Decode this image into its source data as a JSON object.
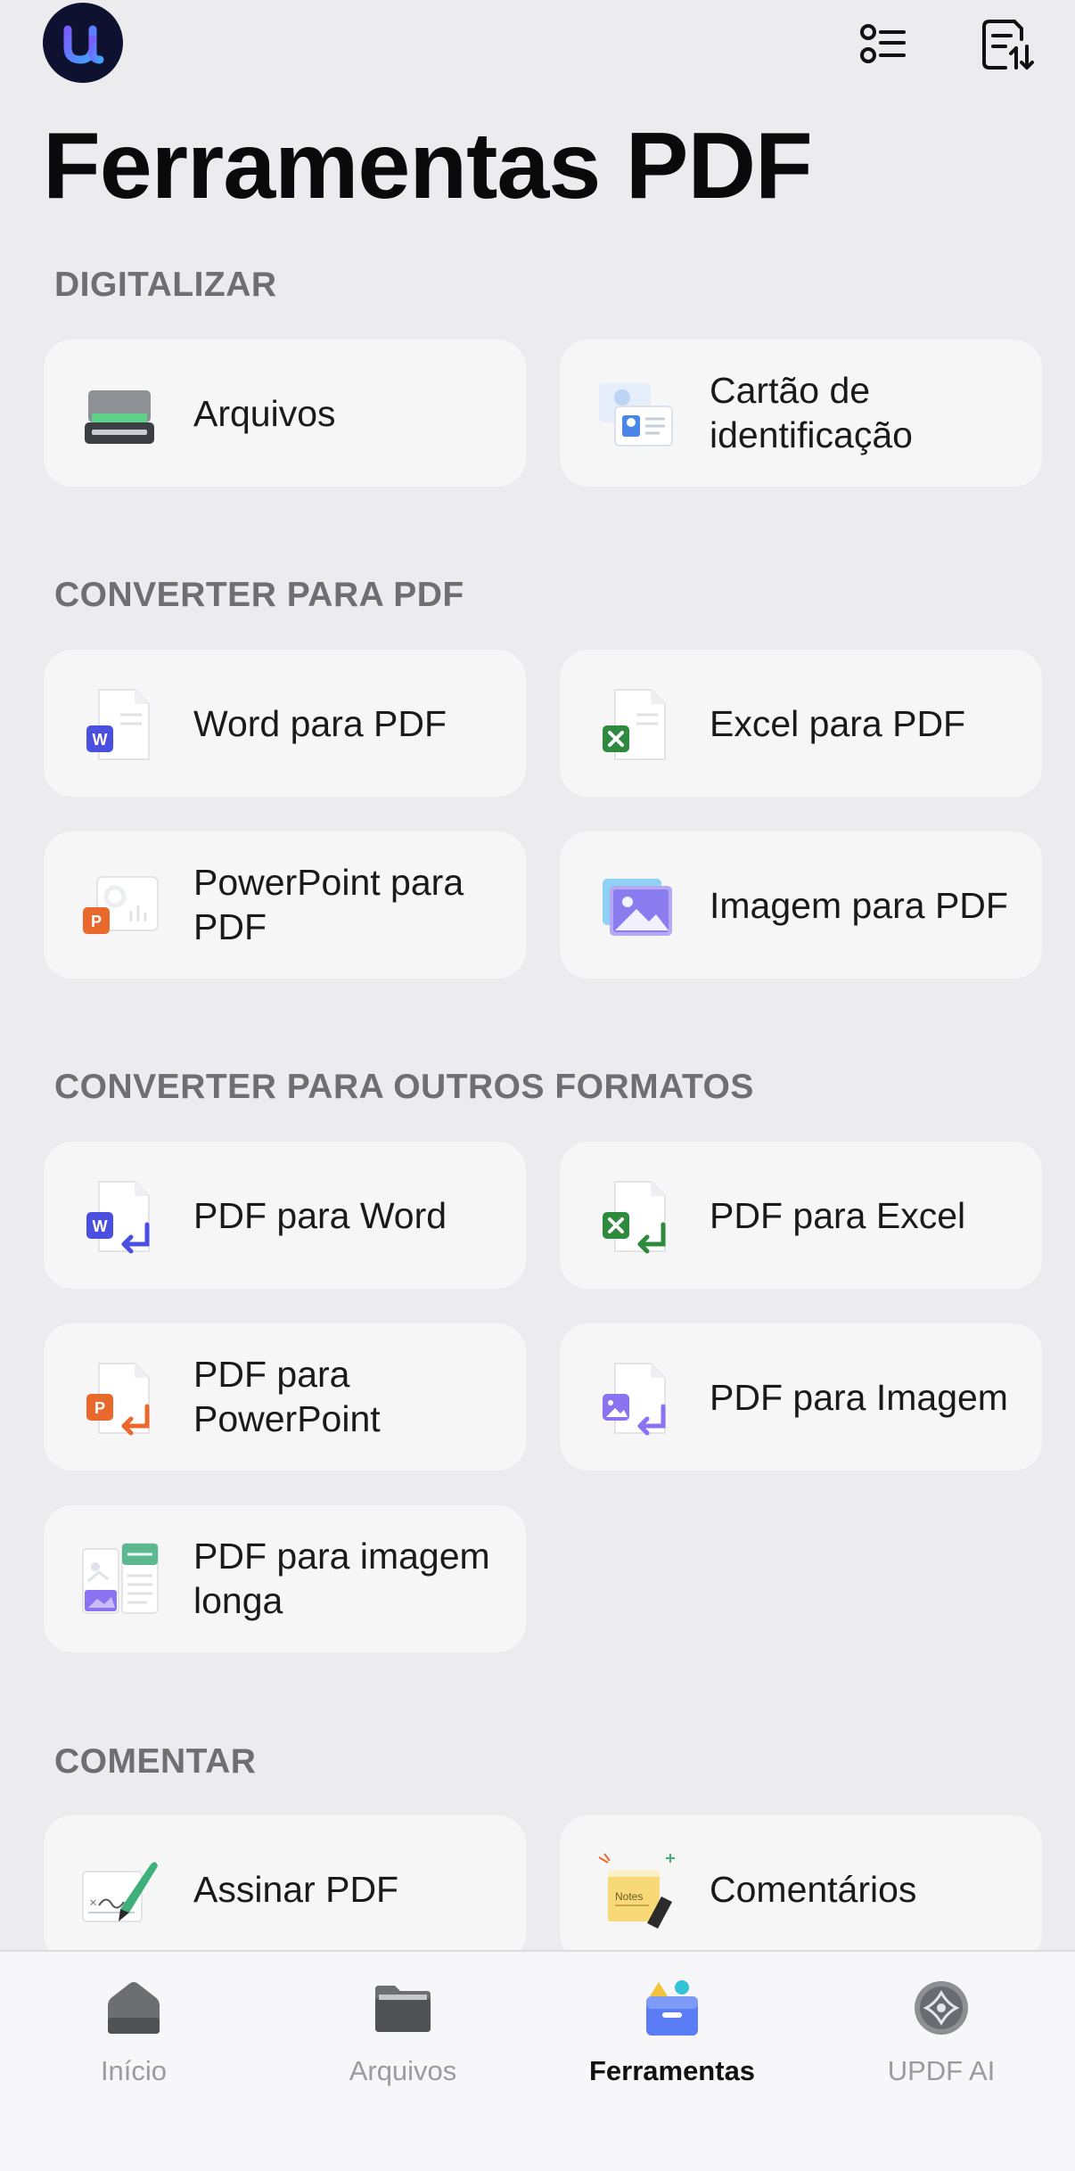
{
  "header": {
    "title": "Ferramentas PDF"
  },
  "sections": {
    "digitalizar": {
      "title": "DIGITALIZAR",
      "items": [
        "Arquivos",
        "Cartão de identificação"
      ]
    },
    "converter_para_pdf": {
      "title": "CONVERTER PARA PDF",
      "items": [
        "Word para PDF",
        "Excel para PDF",
        "PowerPoint para PDF",
        "Imagem para PDF"
      ]
    },
    "converter_outros": {
      "title": "CONVERTER PARA OUTROS FORMATOS",
      "items": [
        "PDF para Word",
        "PDF para Excel",
        "PDF para PowerPoint",
        "PDF para Imagem",
        "PDF para imagem longa"
      ]
    },
    "comentar": {
      "title": "COMENTAR",
      "items": [
        "Assinar PDF",
        "Comentários"
      ]
    }
  },
  "tabs": [
    "Início",
    "Arquivos",
    "Ferramentas",
    "UPDF AI"
  ],
  "active_tab": "Ferramentas",
  "colors": {
    "background": "#ececee",
    "card": "#f6f6f7",
    "section_title": "#6e6e73",
    "word": "#4b4fe0",
    "excel": "#2e8a3d",
    "powerpoint": "#e9692c",
    "image": "#8a72f0"
  },
  "icons": {
    "logo": "updf-logo-icon",
    "top_left": "list-view-icon",
    "top_right": "sort-document-icon"
  }
}
